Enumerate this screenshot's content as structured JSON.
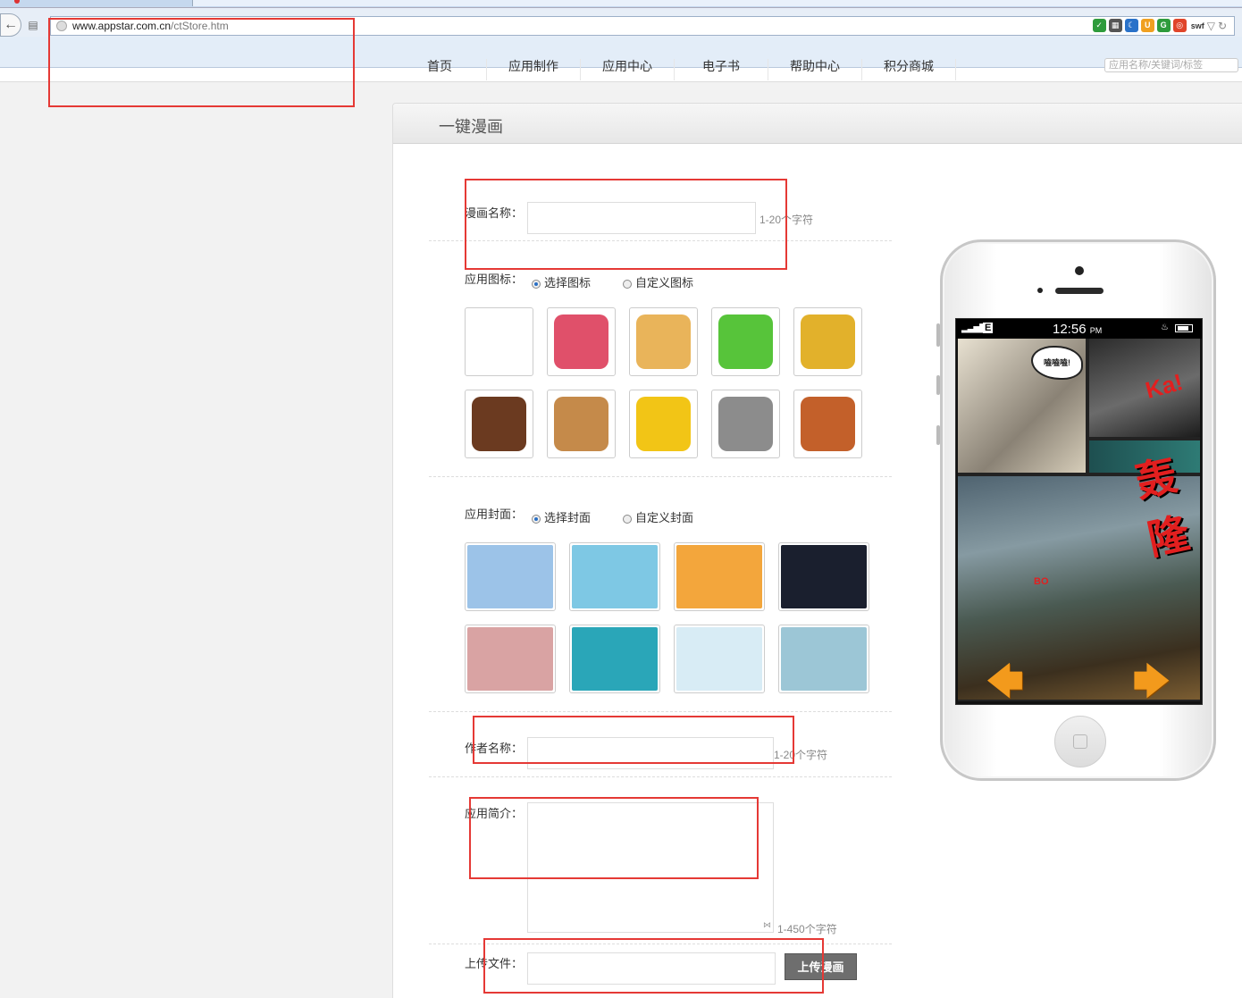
{
  "browser": {
    "url_host": "www.appstar.com.cn",
    "url_path": "/ctStore.htm",
    "extensions": [
      {
        "name": "shield-icon",
        "color": "#2e9b3c",
        "glyph": "✓"
      },
      {
        "name": "qr-code-icon",
        "color": "#555555",
        "glyph": "▦"
      },
      {
        "name": "moon-icon",
        "color": "#2a72c9",
        "glyph": "☾"
      },
      {
        "name": "u-icon",
        "color": "#f0a020",
        "glyph": "U"
      },
      {
        "name": "g-icon",
        "color": "#2e9b3c",
        "glyph": "G"
      },
      {
        "name": "swf-icon",
        "color": "#e0452a",
        "glyph": "◎"
      }
    ],
    "swf_label": "swf"
  },
  "nav": {
    "items": [
      "首页",
      "应用制作",
      "应用中心",
      "电子书",
      "帮助中心",
      "积分商城"
    ],
    "search_placeholder": "应用名称/关键词/标签"
  },
  "panel": {
    "title": "一键漫画"
  },
  "form": {
    "name_label": "漫画名称：",
    "name_hint": "1-20个字符",
    "icon_label": "应用图标：",
    "icon_options": [
      "选择图标",
      "自定义图标"
    ],
    "cover_label": "应用封面：",
    "cover_options": [
      "选择封面",
      "自定义封面"
    ],
    "author_label": "作者名称：",
    "author_hint": "1-20个字符",
    "intro_label": "应用简介：",
    "intro_hint": "1-450个字符",
    "upload_label": "上传文件：",
    "upload_button": "上传漫画"
  },
  "icons": [
    {
      "name": "swoosh-logo-icon",
      "bg": "#ffffff"
    },
    {
      "name": "paintbrush-icon",
      "bg": "#e0506a"
    },
    {
      "name": "photo-album-icon",
      "bg": "#e9b45a"
    },
    {
      "name": "frog-face-icon",
      "bg": "#57c43a"
    },
    {
      "name": "sticker-icon",
      "bg": "#e2b12b"
    },
    {
      "name": "photo-frame-icon",
      "bg": "#6b3a20"
    },
    {
      "name": "cat-notebook-icon",
      "bg": "#c58a4a"
    },
    {
      "name": "smiley-icon",
      "bg": "#f2c516"
    },
    {
      "name": "umbrella-icon",
      "bg": "#8c8c8c"
    },
    {
      "name": "picture-frame-icon",
      "bg": "#c3602a"
    }
  ],
  "covers": [
    {
      "name": "cover-scarecrow",
      "bg": "#9cc3e8"
    },
    {
      "name": "cover-couple",
      "bg": "#7ec8e4"
    },
    {
      "name": "cover-sofa-girl",
      "bg": "#f3a63c"
    },
    {
      "name": "cover-dark-scene",
      "bg": "#1a1f2e"
    },
    {
      "name": "cover-twins",
      "bg": "#d9a3a3"
    },
    {
      "name": "cover-woman",
      "bg": "#2aa6b8"
    },
    {
      "name": "cover-clothesline",
      "bg": "#d8ecf5"
    },
    {
      "name": "cover-kids-photo",
      "bg": "#9cc6d6"
    }
  ],
  "phone": {
    "time": "12:56",
    "ampm": "PM",
    "network": "E",
    "comic_text": {
      "burst": "嗑嗑嗑!",
      "ka": "Ka!",
      "kanji": "轰隆",
      "bo": "BO"
    }
  }
}
